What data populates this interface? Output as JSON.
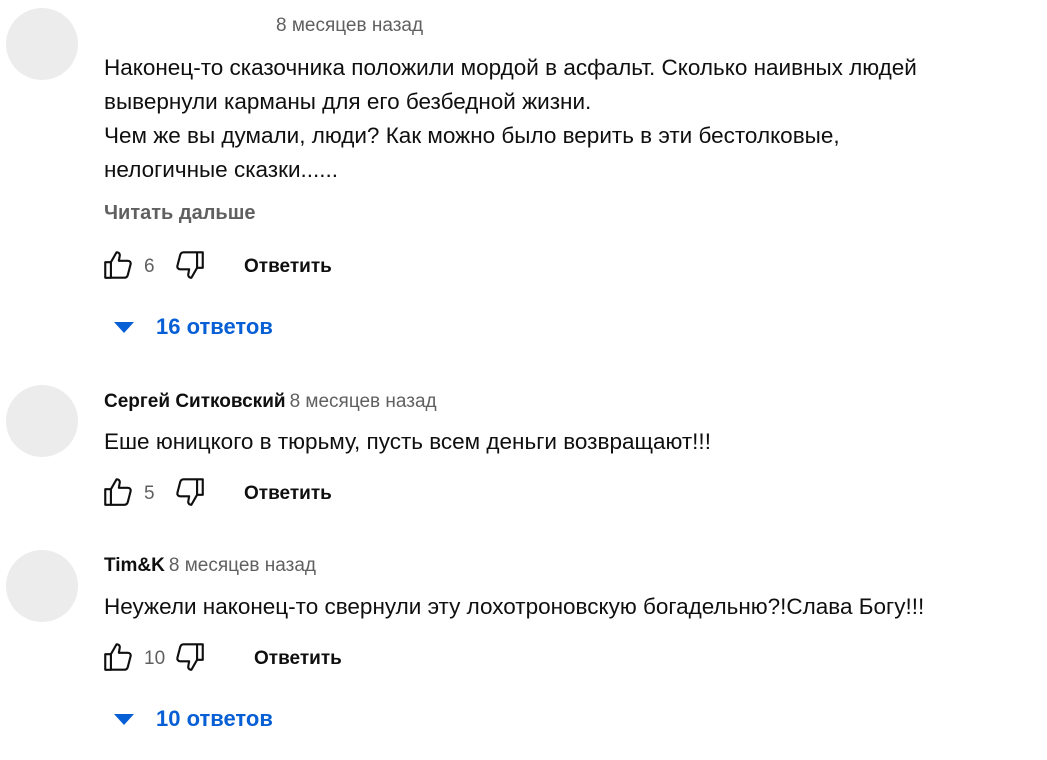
{
  "comments": [
    {
      "author": "",
      "time": "8 месяцев назад",
      "text": "Наконец-то сказочника положили мордой в асфальт. Сколько наивных людей\nвывернули карманы для его безбедной жизни.\nЧем же вы думали,  люди? Как можно было верить в эти бестолковые,\nнелогичные сказки......",
      "read_more": "Читать дальше",
      "likes": "6",
      "reply_label": "Ответить",
      "replies_label": "16 ответов"
    },
    {
      "author": "Сергей Ситковский",
      "time": "8 месяцев назад",
      "text": "Еше юницкого в тюрьму, пусть всем деньги возвращают!!!",
      "likes": "5",
      "reply_label": "Ответить"
    },
    {
      "author": "Tim&K",
      "time": "8 месяцев назад",
      "text": "Неужели наконец-то свернули эту лохотроновскую богадельню?!Слава Богу!!!",
      "likes": "10",
      "reply_label": "Ответить",
      "replies_label": "10 ответов"
    }
  ],
  "colors": {
    "link": "#065fd4",
    "secondary_text": "#606060",
    "avatar_placeholder": "#ececec"
  },
  "icons": [
    "thumb-up-icon",
    "thumb-down-icon",
    "caret-down-icon"
  ]
}
